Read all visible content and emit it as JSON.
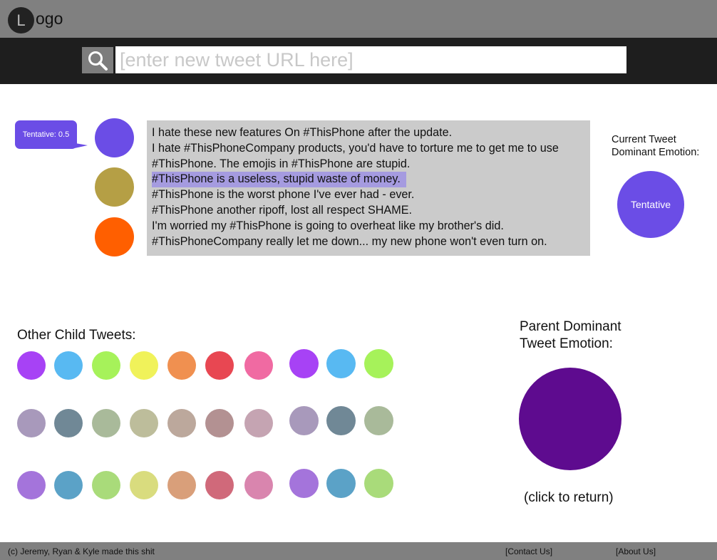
{
  "header": {
    "logo_initial": "L",
    "logo_rest": "ogo"
  },
  "search": {
    "placeholder": "[enter new tweet URL here]",
    "icon": "search-icon"
  },
  "tooltip": {
    "text": "Tentative: 0.5"
  },
  "emotion_dots": [
    "#6b4de6",
    "#b59f45",
    "#ff5f00"
  ],
  "tweets": [
    "I hate these new features On #ThisPhone after the update.",
    "I hate #ThisPhoneCompany products, you'd have to torture me to get me to use",
    "#ThisPhone. The emojis in #ThisPhone are stupid.",
    "#ThisPhone is a useless, stupid waste of money.",
    "#ThisPhone is the worst phone I've ever had - ever.",
    "#ThisPhone another ripoff, lost all respect SHAME.",
    "I'm worried my #ThisPhone is going to overheat like my brother's did.",
    "#ThisPhoneCompany really let me down... my new phone won't even turn on."
  ],
  "highlighted_tweet_index": 3,
  "current": {
    "label_line1": "Current Tweet",
    "label_line2": "Dominant Emotion:",
    "emotion": "Tentative",
    "color": "#6b4de6"
  },
  "other_child": {
    "label": "Other Child Tweets:",
    "rows": [
      [
        "#a742f5",
        "#58b9f2",
        "#a6f25a",
        "#f0f25a",
        "#f09050",
        "#e84752",
        "#f06aa2",
        "#a742f5",
        "#58b9f2",
        "#a6f25a"
      ],
      [
        "#a899bb",
        "#708896",
        "#a9ba9a",
        "#bdbd9b",
        "#bca89c",
        "#b39192",
        "#c5a4b2",
        "#a899bb",
        "#708896",
        "#a9ba9a"
      ],
      [
        "#a474db",
        "#5ba2c7",
        "#a9db7a",
        "#d9dc7e",
        "#d99f7a",
        "#d0697a",
        "#d985ae",
        "#a474db",
        "#5ba2c7",
        "#a9db7a"
      ]
    ]
  },
  "parent": {
    "label_line1": "Parent Dominant",
    "label_line2": "Tweet Emotion:",
    "color": "#5e0b8f",
    "click_text": "(click to return)"
  },
  "footer": {
    "credit": "(c) Jeremy, Ryan & Kyle made this shit",
    "contact": "[Contact Us]",
    "about": "[About Us]"
  }
}
